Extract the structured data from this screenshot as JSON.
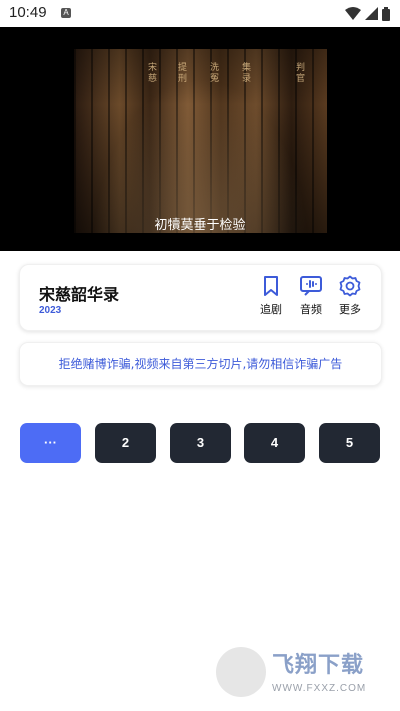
{
  "status_bar": {
    "time": "10:49",
    "notification_icon": "A"
  },
  "video": {
    "subtitle": "初犢莫垂于检验",
    "art_text": [
      "宋慈",
      "提刑",
      "洗冤",
      "集录",
      "判官"
    ]
  },
  "drama": {
    "title": "宋慈韶华录",
    "year": "2023"
  },
  "actions": [
    {
      "label": "追剧",
      "icon": "bookmark-icon"
    },
    {
      "label": "音频",
      "icon": "audio-icon"
    },
    {
      "label": "更多",
      "icon": "gear-icon"
    }
  ],
  "notice": "拒绝赌博诈骗,视频来自第三方切片,请勿相信诈骗广告",
  "episodes": [
    "···",
    "2",
    "3",
    "4",
    "5"
  ],
  "watermark": {
    "title": "飞翔下载",
    "url": "WWW.FXXZ.COM"
  },
  "colors": {
    "accent": "#4d6cf5",
    "episode_bg": "#222833",
    "link": "#3d5bd9"
  }
}
